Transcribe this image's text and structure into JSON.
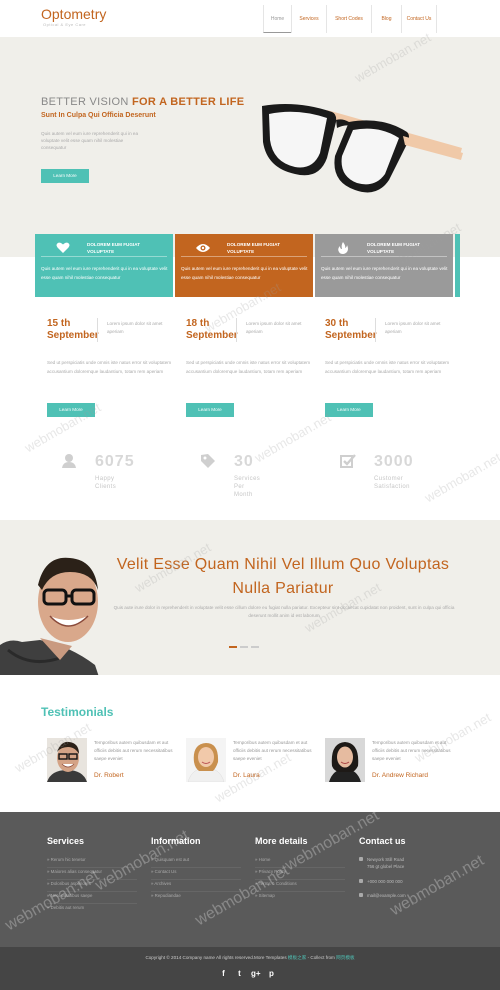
{
  "header": {
    "logo_title": "Optometry",
    "logo_subtitle": "Optical & Eye Care",
    "nav": [
      {
        "label": "Home",
        "active": true
      },
      {
        "label": "Services",
        "active": false
      },
      {
        "label": "Short Codes",
        "active": false
      },
      {
        "label": "Blog",
        "active": false
      },
      {
        "label": "Contact Us",
        "active": false
      }
    ]
  },
  "hero": {
    "headline_plain": "BETTER VISION ",
    "headline_accent": "FOR A BETTER LIFE",
    "subheading": "Sunt In Culpa Qui Officia Deserunt",
    "paragraph": "Quis autem vel eum iure reprehenderit qui in ea voluptate velit esse quam nihil molestiae consequatur",
    "button": "Learn More"
  },
  "features": [
    {
      "title": "DOLOREM EUM FUGIAT VOLUPTATE",
      "text": "Quis autem vel eum iure reprehenderit qui in ea voluptate velit esse quam nihil molestiae consequatur",
      "color": "#4fc1b5",
      "icon": "heart-icon"
    },
    {
      "title": "DOLOREM EUM FUGIAT VOLUPTATE",
      "text": "Quis autem vel eum iure reprehenderit qui in ea voluptate velit esse quam nihil molestiae consequatur",
      "color": "#c2651f",
      "icon": "eye-icon"
    },
    {
      "title": "DOLOREM EUM FUGIAT VOLUPTATE",
      "text": "Quis autem vel eum iure reprehenderit qui in ea voluptate velit esse quam nihil molestiae consequatur",
      "color": "#9a9a9a",
      "icon": "flame-icon"
    }
  ],
  "events": [
    {
      "day": "15 th",
      "month": "September",
      "side": "Lorem ipsum dolor sit amet aperiam",
      "text": "Sed ut perspiciatis unde omnis iste natus error sit voluptatem accusantium doloremque laudantium, totam rem aperiam",
      "button": "Learn More"
    },
    {
      "day": "18 th",
      "month": "September",
      "side": "Lorem ipsum dolor sit amet aperiam",
      "text": "Sed ut perspiciatis unde omnis iste natus error sit voluptatem accusantium doloremque laudantium, totam rem aperiam",
      "button": "Learn More"
    },
    {
      "day": "30 th",
      "month": "September",
      "side": "Lorem ipsum dolor sit amet aperiam",
      "text": "Sed ut perspiciatis unde omnis iste natus error sit voluptatem accusantium doloremque laudantium, totam rem aperiam",
      "button": "Learn More"
    }
  ],
  "stats": [
    {
      "number": "6075",
      "label": "Happy Clients",
      "icon": "user-icon"
    },
    {
      "number": "30",
      "label": "Services Per Month",
      "icon": "tag-icon"
    },
    {
      "number": "3000",
      "label": "Customer Satisfaction",
      "icon": "checkbox-icon"
    }
  ],
  "band": {
    "heading": "Velit Esse Quam Nihil Vel Illum Quo Voluptas Nulla Pariatur",
    "paragraph": "Quis aute irure dolor in reprehenderit in voluptate velit esse cillum dolore eu fugiat nulla pariatur. Excepteur sint occaecat cupidatat non proident, sunt in culpa qui officia deserunt mollit anim id est laborum"
  },
  "testimonials": {
    "title": "Testimonials",
    "items": [
      {
        "text": "Temporibus autem quibusdam et aut officiis debitis aut rerum necessitatibus saepe eveniet",
        "name": "Dr. Robert"
      },
      {
        "text": "Temporibus autem quibusdam et aut officiis debitis aut rerum necessitatibus saepe eveniet",
        "name": "Dr. Laura"
      },
      {
        "text": "Temporibus autem quibusdam et aut officiis debitis aut rerum necessitatibus saepe eveniet",
        "name": "Dr. Andrew Richard"
      }
    ]
  },
  "footer": {
    "services": {
      "heading": "Services",
      "items": [
        "Rerum hic tenetur",
        "Maiores alias consequatur",
        "Doloribus asperiores",
        "Necessitatibus saepe",
        "Debitis aut rerum"
      ]
    },
    "information": {
      "heading": "Information",
      "items": [
        "Quisquam est aut",
        "Contact Us",
        "Archives",
        "Repudiandae"
      ]
    },
    "more": {
      "heading": "More details",
      "items": [
        "Home",
        "Privacy Policy",
        "Terms & Conditions",
        "Sitemap"
      ]
    },
    "contact": {
      "heading": "Contact us",
      "address_1": "Newyork Still Road",
      "address_2": "756 gt globel Place",
      "phone": "+000 000 000 000",
      "email": "mail@example.com"
    }
  },
  "bottom": {
    "copyright": "Copyright © 2014 Company name All rights reserved.More Templates ",
    "link1": "模板之家",
    "collect": " - Collect from ",
    "link2": "网页模板",
    "social": [
      "f",
      "t",
      "g+",
      "p"
    ]
  },
  "watermark": "webmoban.net"
}
